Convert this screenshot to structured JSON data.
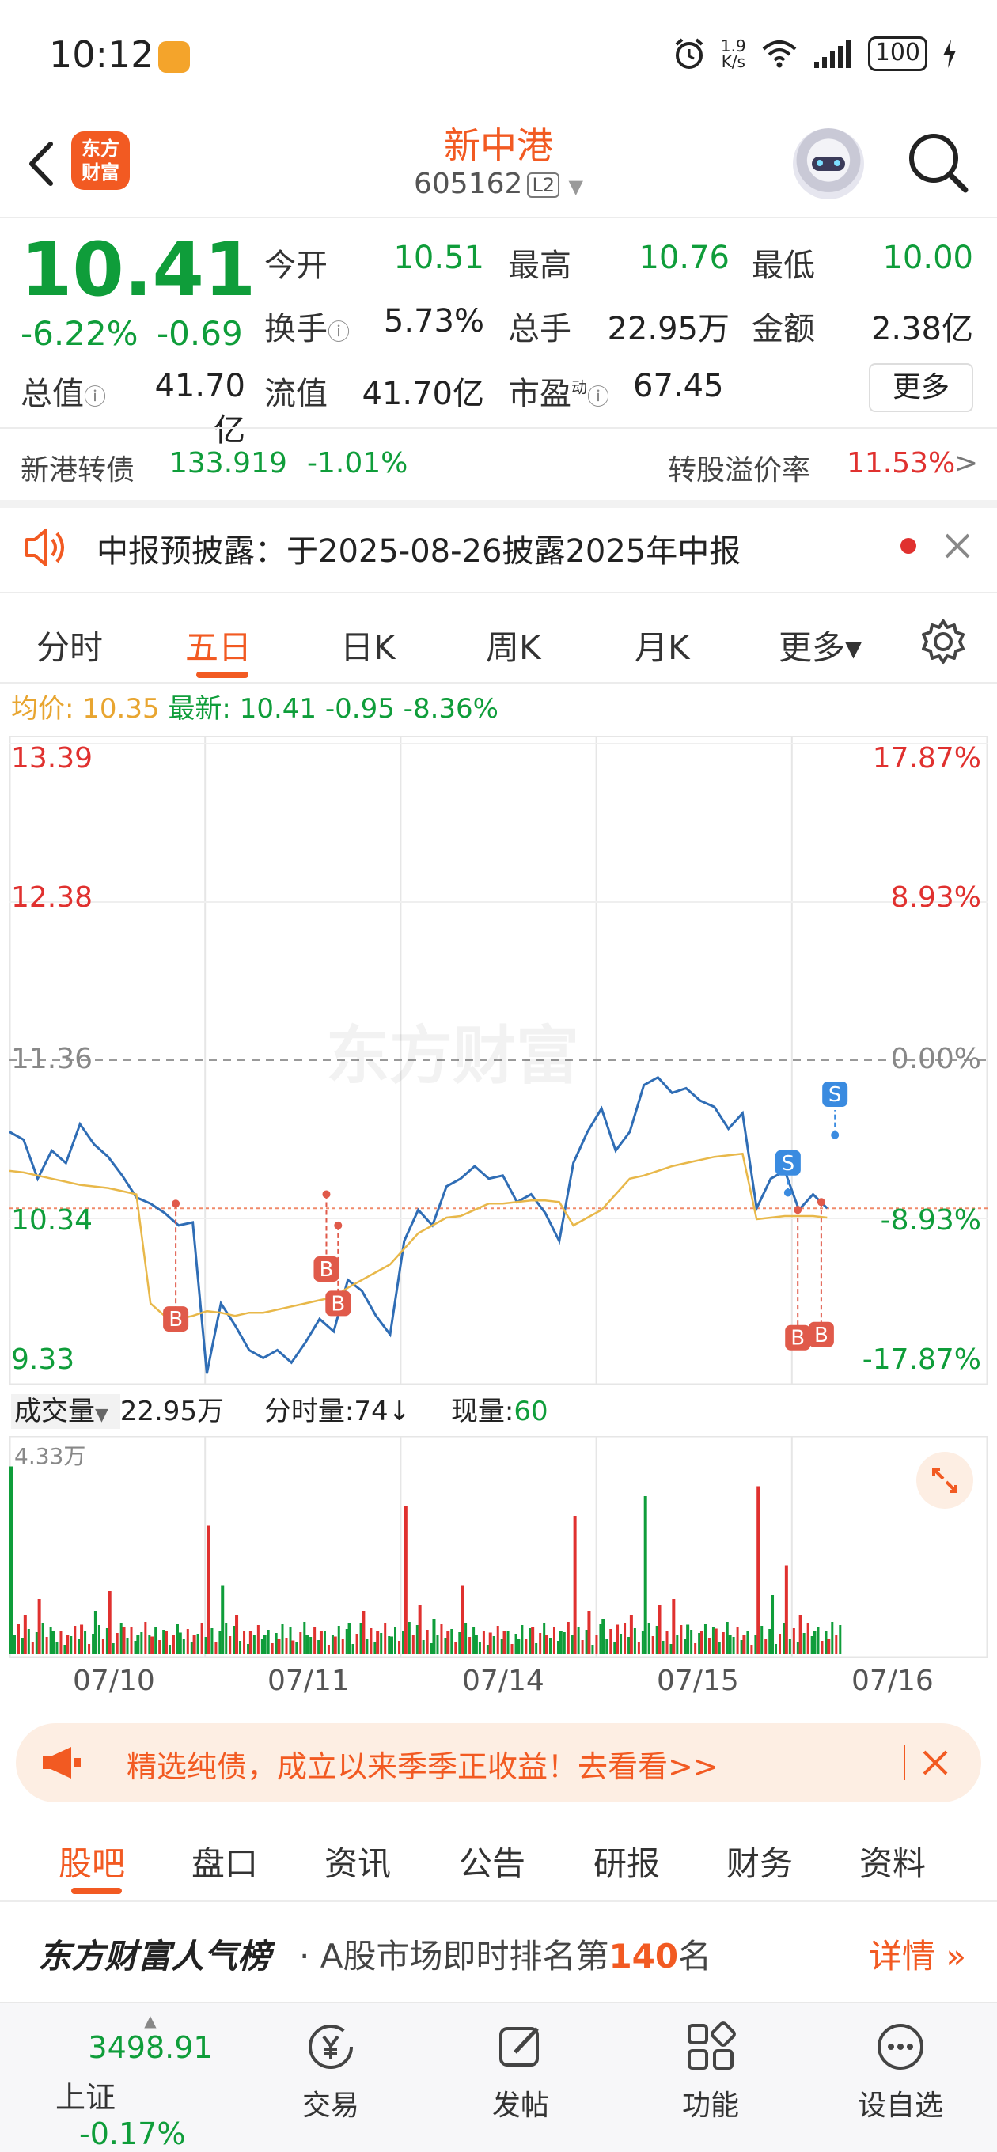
{
  "status_bar": {
    "time": "10:12",
    "net_speed_top": "1.9",
    "net_speed_unit": "K/s",
    "battery": "100"
  },
  "header": {
    "logo_text": [
      "东方",
      "财富"
    ],
    "stock_name": "新中港",
    "stock_code": "605162",
    "level_badge": "L2"
  },
  "quote": {
    "price": "10.41",
    "change_pct": "-6.22%",
    "change_abs": "-0.69",
    "open_label": "今开",
    "open": "10.51",
    "high_label": "最高",
    "high": "10.76",
    "low_label": "最低",
    "low": "10.00",
    "turnover_label": "换手",
    "turnover": "5.73%",
    "volume_label": "总手",
    "volume": "22.95万",
    "amount_label": "金额",
    "amount": "2.38亿",
    "mktcap_label": "总值",
    "mktcap": "41.70亿",
    "float_label": "流值",
    "float_cap": "41.70亿",
    "pe_label": "市盈",
    "pe_sup": "动",
    "pe": "67.45",
    "more_label": "更多"
  },
  "bond": {
    "name": "新港转债",
    "price": "133.919",
    "change": "-1.01%",
    "premium_label": "转股溢价率",
    "premium": "11.53%",
    "arrow": ">"
  },
  "notice": {
    "text": "中报预披露：于2025-08-26披露2025年中报"
  },
  "chart_tabs": [
    "分时",
    "五日",
    "日K",
    "周K",
    "月K",
    "更多▾"
  ],
  "avg_row": {
    "avg_label": "均价:",
    "avg": "10.35",
    "latest_label": "最新:",
    "latest": "10.41",
    "chg": "-0.95",
    "pct": "-8.36%"
  },
  "watermark": "东方财富",
  "colors": {
    "accent": "#f25a22",
    "up": "#e0312f",
    "down": "#0f9d3a",
    "avg_line": "#e8b84a",
    "price_line": "#2f6db5"
  },
  "chart_data": {
    "type": "line",
    "title": "",
    "prev_close": 11.36,
    "y_ticks_left": [
      "13.39",
      "12.38",
      "11.36",
      "10.34",
      "9.33"
    ],
    "y_ticks_right": [
      "17.87%",
      "8.93%",
      "0.00%",
      "-8.93%",
      "-17.87%"
    ],
    "ylim": [
      9.33,
      13.39
    ],
    "x_labels": [
      "07/10",
      "07/11",
      "07/14",
      "07/15",
      "07/16"
    ],
    "days": 5,
    "series": [
      {
        "values": [
          10.9,
          10.85,
          10.6,
          10.78,
          10.7,
          10.95,
          10.82,
          10.74,
          10.62,
          10.48,
          10.44,
          10.38,
          10.3,
          10.32,
          9.35,
          9.8,
          9.66,
          9.5,
          9.45,
          9.5,
          9.42,
          9.55,
          9.7,
          9.62,
          9.95,
          9.88,
          9.72,
          9.6,
          10.2,
          10.4,
          10.3,
          10.55,
          10.6,
          10.68,
          10.6,
          10.62,
          10.45,
          10.5,
          10.38,
          10.2,
          10.7,
          10.9,
          11.05,
          10.78,
          10.9,
          11.2,
          11.25,
          11.15,
          11.18,
          11.1,
          11.06,
          10.92,
          11.02,
          10.41,
          10.6,
          10.65,
          10.4,
          10.5,
          10.41
        ],
        "last_day_points": 8
      },
      {
        "values": [
          10.65,
          10.64,
          10.62,
          10.6,
          10.58,
          10.56,
          10.55,
          10.54,
          10.52,
          10.5,
          9.8,
          9.72,
          9.7,
          9.72,
          9.75,
          9.74,
          9.72,
          9.74,
          9.74,
          9.76,
          9.78,
          9.8,
          9.82,
          9.84,
          9.9,
          9.95,
          10.0,
          10.05,
          10.15,
          10.25,
          10.3,
          10.35,
          10.36,
          10.4,
          10.44,
          10.44,
          10.45,
          10.46,
          10.46,
          10.45,
          10.3,
          10.35,
          10.4,
          10.5,
          10.6,
          10.62,
          10.65,
          10.68,
          10.7,
          10.72,
          10.74,
          10.75,
          10.76,
          10.34,
          10.35,
          10.36,
          10.36,
          10.36,
          10.35
        ]
      }
    ],
    "trade_marks": [
      {
        "label": "B",
        "day": 0,
        "y_top": 10.44,
        "y_bottom": 9.7
      },
      {
        "label": "B",
        "day": 1,
        "y_top": 10.5,
        "y_bottom": 10.02
      },
      {
        "label": "B",
        "day": 1,
        "y_top": 10.3,
        "y_bottom": 9.8
      },
      {
        "label": "S",
        "day": 3,
        "y_top": 10.51,
        "y_bottom": 10.6
      },
      {
        "label": "S",
        "day": 4,
        "y_top": 10.88,
        "y_bottom": 11.04
      },
      {
        "label": "B",
        "day": 4,
        "y_top": 10.4,
        "y_bottom": 9.58
      },
      {
        "label": "B",
        "day": 4,
        "y_top": 10.45,
        "y_bottom": 9.6
      }
    ]
  },
  "volume": {
    "label": "成交量",
    "total": "22.95万",
    "interval_label": "分时量:",
    "interval": "74",
    "now_label": "现量:",
    "now": "60",
    "max_label": "4.33万",
    "bars": [
      0.95,
      0.2,
      0.28,
      0.12,
      0.1,
      0.15,
      0.22,
      0.32,
      0.14,
      0.1,
      0.09,
      0.12,
      0.11,
      0.1,
      0.65,
      0.35,
      0.2,
      0.12,
      0.1,
      0.08,
      0.07,
      0.1,
      0.12,
      0.09,
      0.16,
      0.22,
      0.12,
      0.09,
      0.75,
      0.25,
      0.18,
      0.12,
      0.35,
      0.1,
      0.11,
      0.12,
      0.08,
      0.14,
      0.1,
      0.12,
      0.7,
      0.22,
      0.18,
      0.15,
      0.2,
      0.8,
      0.25,
      0.28,
      0.15,
      0.12,
      0.13,
      0.1,
      0.1,
      0.85,
      0.3,
      0.45,
      0.2,
      0.12,
      0.08
    ]
  },
  "promo": {
    "text": "精选纯债，成立以来季季正收益！去看看>>"
  },
  "bottom_tabs": [
    "股吧",
    "盘口",
    "资讯",
    "公告",
    "研报",
    "财务",
    "资料"
  ],
  "rank": {
    "brand": "东方财富人气榜",
    "dot": "·",
    "text_pre": "A股市场即时排名第",
    "rank": "140",
    "text_post": "名",
    "detail": "详情"
  },
  "nav": {
    "index_value": "3498.91",
    "index_name": "上证",
    "index_change": "-0.17%",
    "items": [
      "交易",
      "发帖",
      "功能",
      "设自选"
    ]
  }
}
